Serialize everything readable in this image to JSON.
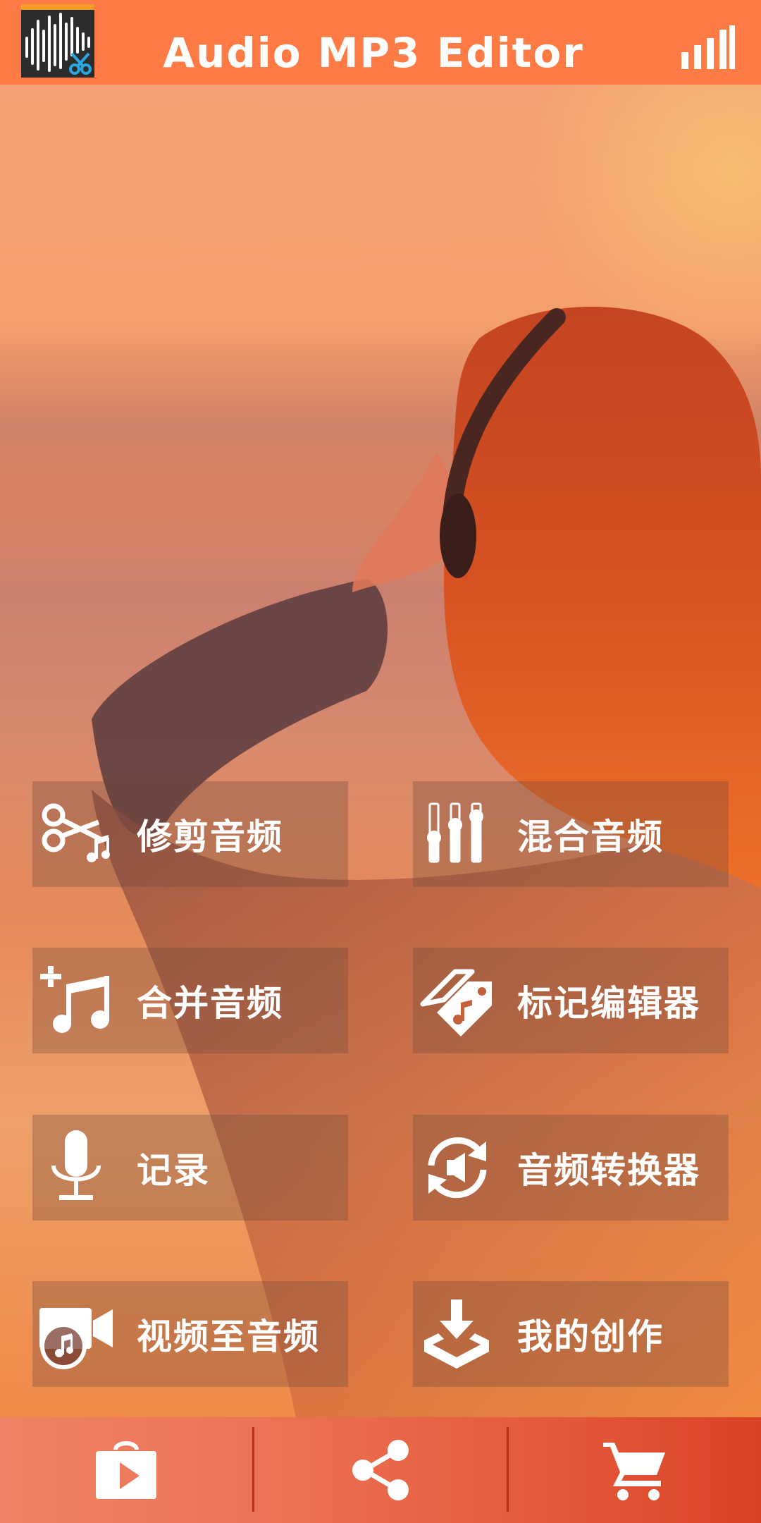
{
  "header": {
    "title": "Audio MP3 Editor",
    "logo_icon": "waveform-scissors-icon",
    "menu_icon": "signal-bars-icon"
  },
  "menu": {
    "items": [
      {
        "id": "trim",
        "label": "修剪音频",
        "icon": "scissors-music-icon"
      },
      {
        "id": "mix",
        "label": "混合音频",
        "icon": "equalizer-sliders-icon"
      },
      {
        "id": "merge",
        "label": "合并音频",
        "icon": "add-music-icon"
      },
      {
        "id": "tag",
        "label": "标记编辑器",
        "icon": "music-tag-icon"
      },
      {
        "id": "record",
        "label": "记录",
        "icon": "microphone-icon"
      },
      {
        "id": "convert",
        "label": "音频转换器",
        "icon": "audio-convert-icon"
      },
      {
        "id": "video",
        "label": "视频至音频",
        "icon": "video-music-icon"
      },
      {
        "id": "creations",
        "label": "我的创作",
        "icon": "download-tray-icon"
      }
    ]
  },
  "bottom_bar": {
    "items": [
      {
        "id": "store",
        "icon": "play-bag-icon"
      },
      {
        "id": "share",
        "icon": "share-icon"
      },
      {
        "id": "cart",
        "icon": "cart-icon"
      }
    ]
  },
  "colors": {
    "header": "#ff7b45",
    "button_overlay": "rgba(110,70,60,0.32)",
    "bottom_bar_start": "#ef8266",
    "bottom_bar_end": "#d94326"
  }
}
